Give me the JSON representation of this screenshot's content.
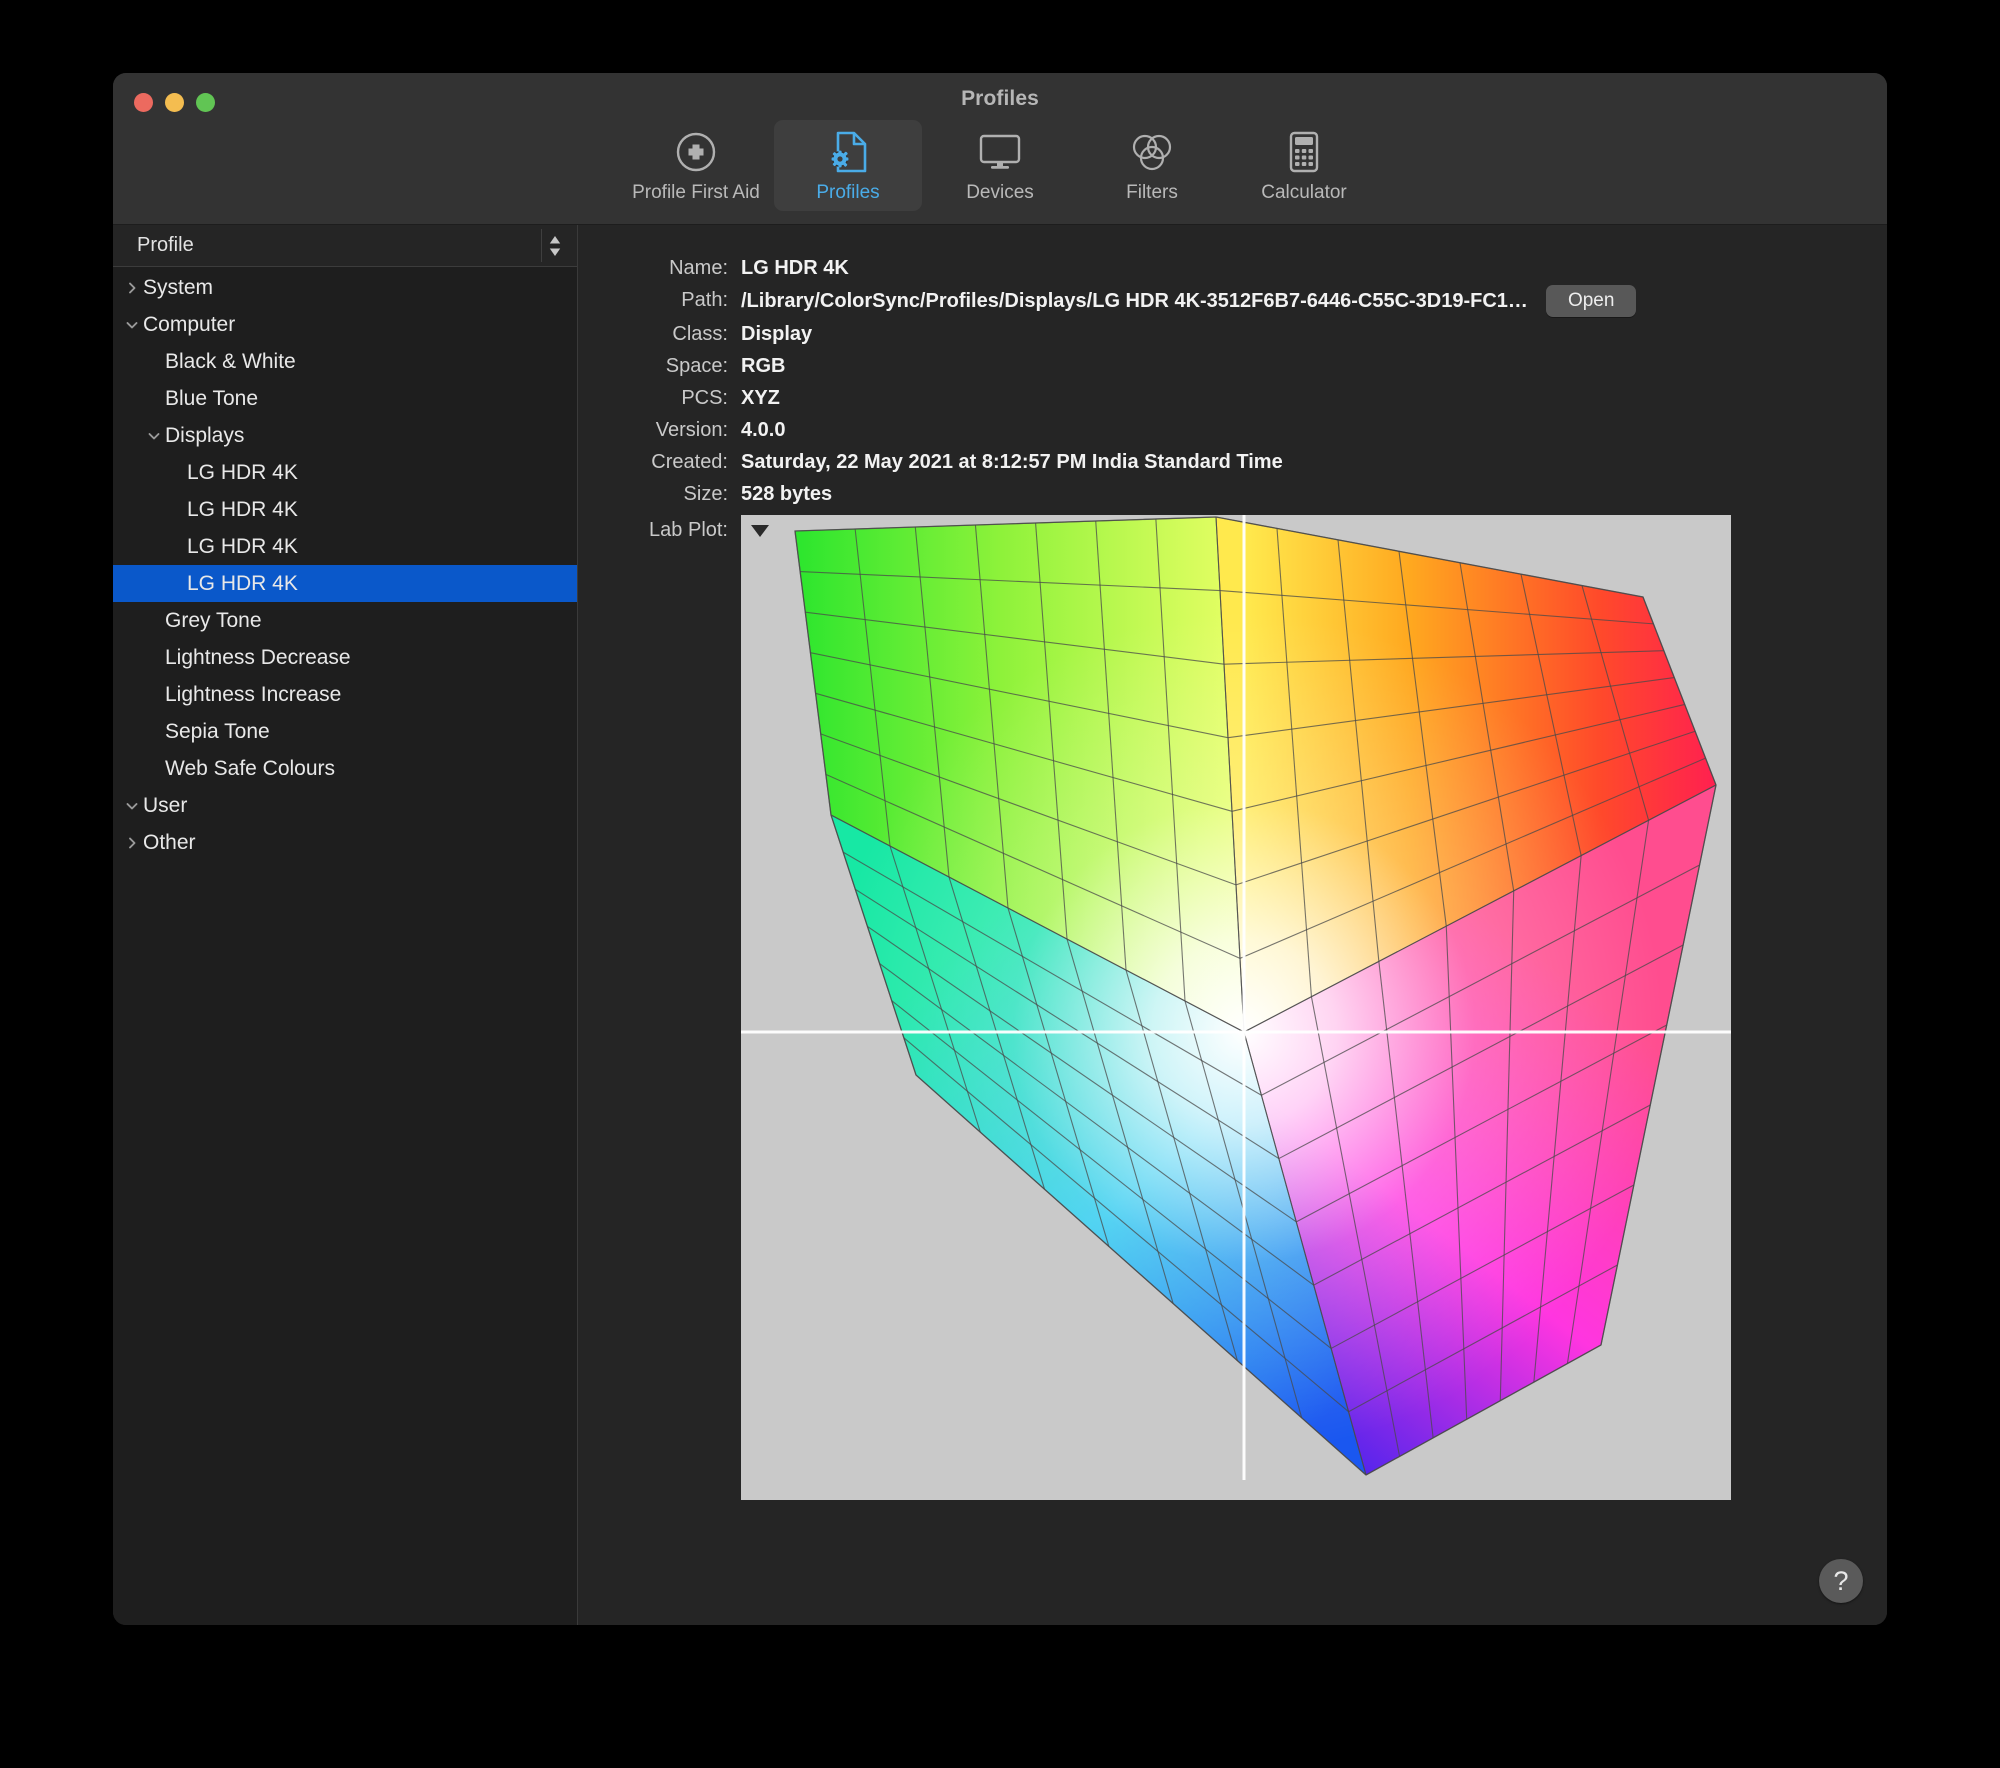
{
  "window": {
    "title": "Profiles",
    "traffic_lights": [
      "close",
      "minimize",
      "zoom"
    ]
  },
  "toolbar": {
    "items": [
      {
        "label": "Profile First Aid",
        "icon": "plus-circle-icon",
        "selected": false
      },
      {
        "label": "Profiles",
        "icon": "profile-document-gear-icon",
        "selected": true
      },
      {
        "label": "Devices",
        "icon": "display-monitor-icon",
        "selected": false
      },
      {
        "label": "Filters",
        "icon": "venn-circles-icon",
        "selected": false
      },
      {
        "label": "Calculator",
        "icon": "calculator-icon",
        "selected": false
      }
    ]
  },
  "sidebar": {
    "column_header": "Profile",
    "sort_control_icon": "sort-chevrons-icon",
    "tree": [
      {
        "label": "System",
        "level": 0,
        "twisty": "collapsed",
        "selected": false
      },
      {
        "label": "Computer",
        "level": 0,
        "twisty": "expanded",
        "selected": false
      },
      {
        "label": "Black & White",
        "level": 1,
        "twisty": "none",
        "selected": false
      },
      {
        "label": "Blue Tone",
        "level": 1,
        "twisty": "none",
        "selected": false
      },
      {
        "label": "Displays",
        "level": 1,
        "twisty": "expanded",
        "selected": false
      },
      {
        "label": "LG HDR 4K",
        "level": 2,
        "twisty": "none",
        "selected": false
      },
      {
        "label": "LG HDR 4K",
        "level": 2,
        "twisty": "none",
        "selected": false
      },
      {
        "label": "LG HDR 4K",
        "level": 2,
        "twisty": "none",
        "selected": false
      },
      {
        "label": "LG HDR 4K",
        "level": 2,
        "twisty": "none",
        "selected": true
      },
      {
        "label": "Grey Tone",
        "level": 1,
        "twisty": "none",
        "selected": false
      },
      {
        "label": "Lightness Decrease",
        "level": 1,
        "twisty": "none",
        "selected": false
      },
      {
        "label": "Lightness Increase",
        "level": 1,
        "twisty": "none",
        "selected": false
      },
      {
        "label": "Sepia Tone",
        "level": 1,
        "twisty": "none",
        "selected": false
      },
      {
        "label": "Web Safe Colours",
        "level": 1,
        "twisty": "none",
        "selected": false
      },
      {
        "label": "User",
        "level": 0,
        "twisty": "expanded",
        "selected": false
      },
      {
        "label": "Other",
        "level": 0,
        "twisty": "collapsed",
        "selected": false
      }
    ]
  },
  "detail": {
    "fields": {
      "name_label": "Name:",
      "name_value": "LG HDR 4K",
      "path_label": "Path:",
      "path_value": "/Library/ColorSync/Profiles/Displays/LG HDR 4K-3512F6B7-6446-C55C-3D19-FC1…",
      "open_label": "Open",
      "class_label": "Class:",
      "class_value": "Display",
      "space_label": "Space:",
      "space_value": "RGB",
      "pcs_label": "PCS:",
      "pcs_value": "XYZ",
      "version_label": "Version:",
      "version_value": "4.0.0",
      "created_label": "Created:",
      "created_value": "Saturday, 22 May 2021 at 8:12:57 PM India Standard Time",
      "size_label": "Size:",
      "size_value": "528 bytes"
    },
    "lab_plot": {
      "label": "Lab Plot:",
      "disclosure_icon": "disclosure-triangle-down-icon",
      "background_color": "#c9c9c9",
      "axis_color": "#ffffff"
    },
    "help_label": "?"
  },
  "colors": {
    "accent_selected_row": "#0a58ca",
    "accent_toolbar_active": "#4aace8",
    "window_background": "#2b2b2b",
    "sidebar_background": "#1e1e1e",
    "detail_background": "#252525",
    "plot_background": "#c9c9c9"
  }
}
